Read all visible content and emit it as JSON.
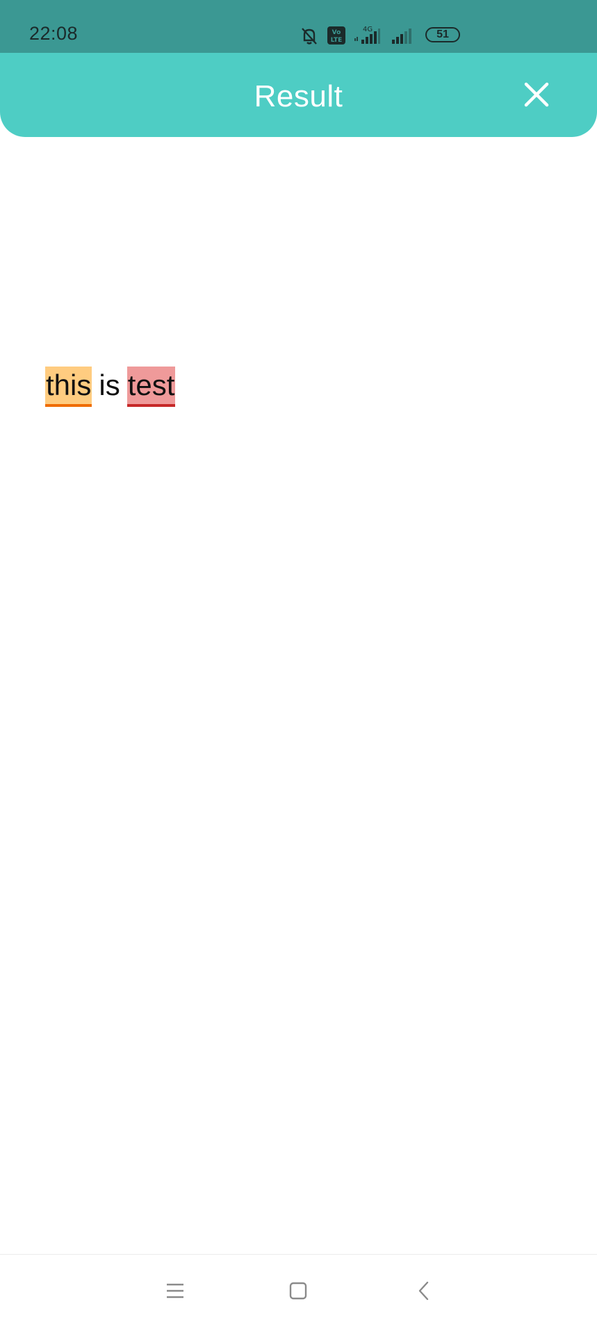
{
  "status_bar": {
    "time": "22:08",
    "network_label": "4G",
    "volte_label": "Vo LTE",
    "battery_level": "51",
    "icons": [
      "bell-muted-icon",
      "volte-icon",
      "signal-4g-icon",
      "signal-icon",
      "battery-icon"
    ]
  },
  "app_bar": {
    "title": "Result",
    "close_icon": "close-icon",
    "color": "#4ecdc4"
  },
  "result": {
    "words": [
      {
        "text": "this",
        "highlight": "warning",
        "color": "#ffcc80",
        "underline": "#ef6c00"
      },
      {
        "text": "is",
        "highlight": "none"
      },
      {
        "text": "test",
        "highlight": "error",
        "color": "#ef9a9a",
        "underline": "#c62828"
      }
    ]
  },
  "nav_bar": {
    "icons": [
      "menu-icon",
      "home-icon",
      "back-icon"
    ]
  }
}
